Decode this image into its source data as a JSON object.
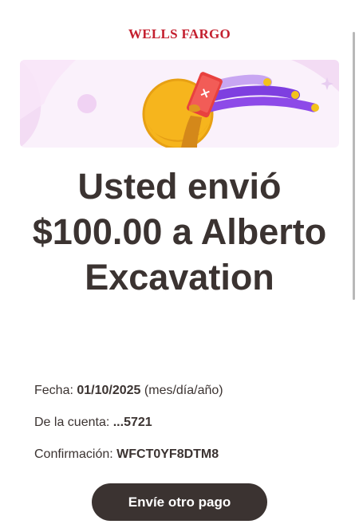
{
  "header": {
    "brand": "WELLS FARGO"
  },
  "hero": {
    "illustration_icon": "phone-payment-illustration",
    "colors": {
      "background": "#f6eaf7",
      "coin": "#f6b51d",
      "coin_shadow": "#e09512",
      "phone": "#e8413f",
      "stripe_purple": "#7e3fe0",
      "stripe_lavender": "#c8a6f2",
      "accent_dot": "#f3c21c"
    }
  },
  "confirmation": {
    "headline": "Usted envió $100.00 a Alberto Excavation",
    "details": [
      {
        "label": "Fecha:",
        "value": "01/10/2025",
        "suffix": "(mes/día/año)"
      },
      {
        "label": "De la cuenta:",
        "value": "...5721",
        "suffix": ""
      },
      {
        "label": "Confirmación:",
        "value": "WFCT0YF8DTM8",
        "suffix": ""
      }
    ]
  },
  "actions": {
    "send_another_label": "Envíe otro pago"
  },
  "colors": {
    "brand_red": "#c4202f",
    "text_dark": "#3b3331",
    "button_bg": "#3b3331",
    "button_text": "#ffffff"
  }
}
